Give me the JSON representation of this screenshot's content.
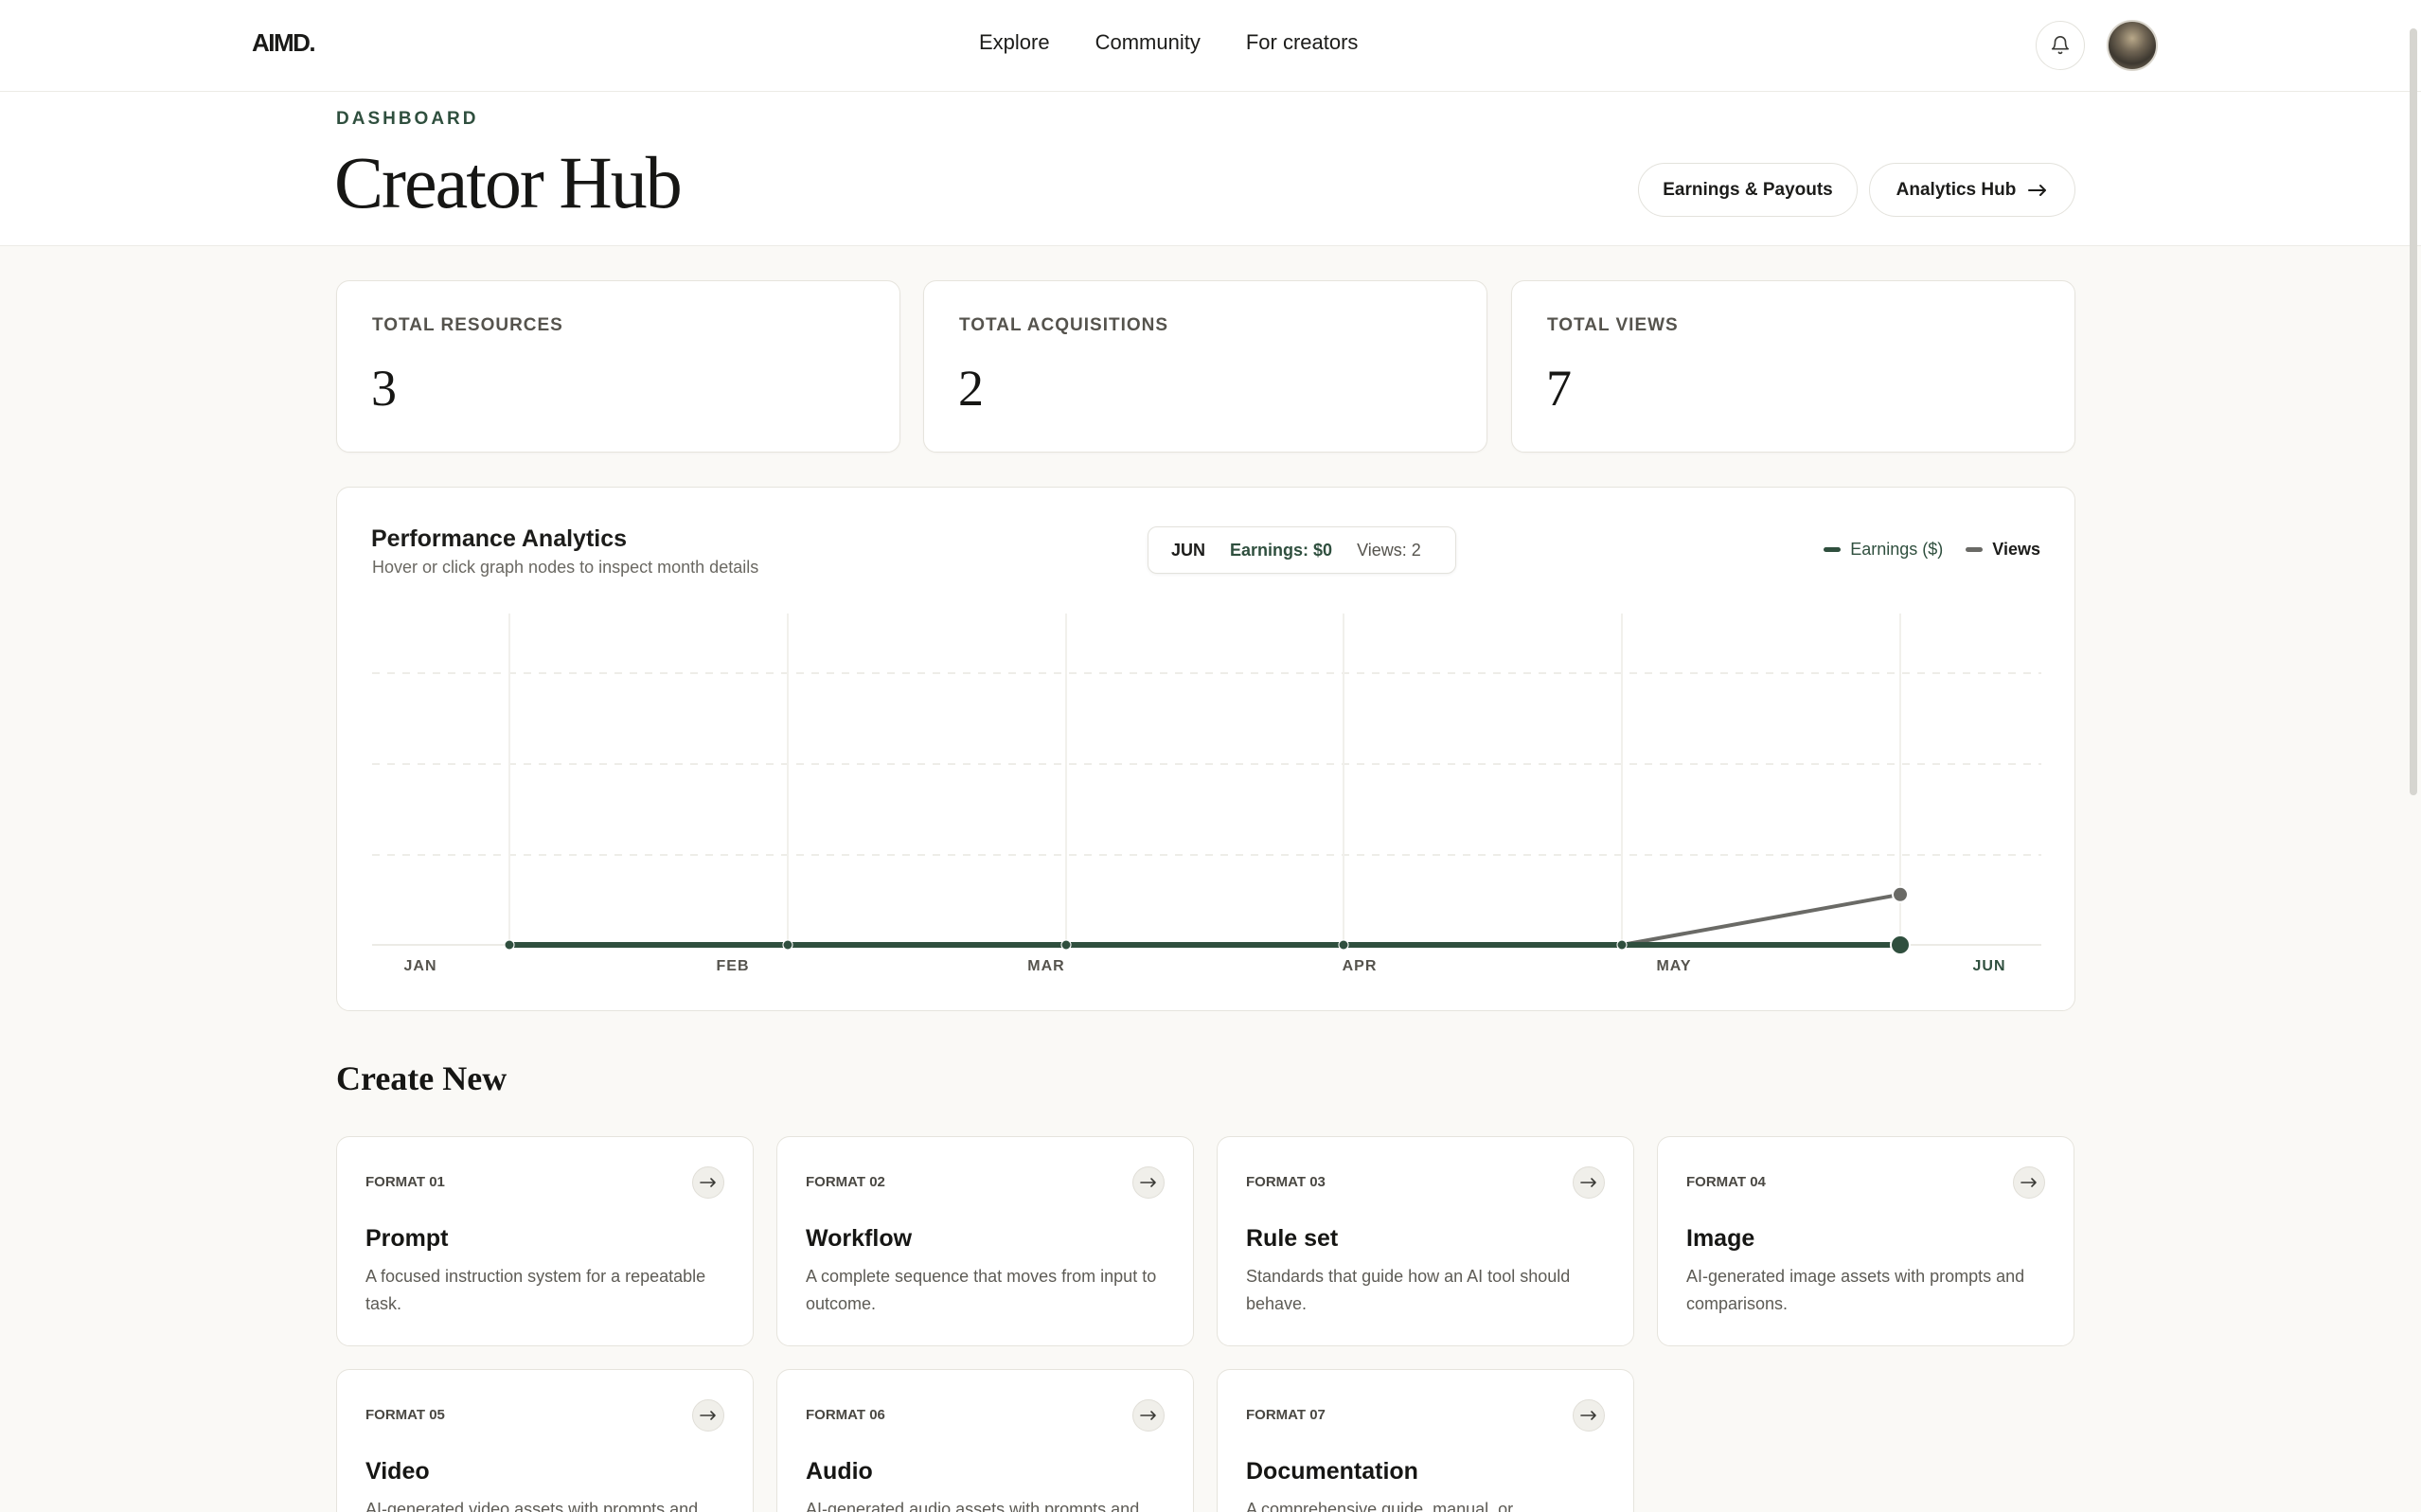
{
  "app": {
    "logo": "AIMD."
  },
  "nav": {
    "items": [
      "Explore",
      "Community",
      "For creators"
    ]
  },
  "header": {
    "eyebrow": "DASHBOARD",
    "title": "Creator Hub",
    "earnings_button": "Earnings & Payouts",
    "analytics_button": "Analytics Hub"
  },
  "stats": [
    {
      "label": "TOTAL RESOURCES",
      "value": "3"
    },
    {
      "label": "TOTAL ACQUISITIONS",
      "value": "2"
    },
    {
      "label": "TOTAL VIEWS",
      "value": "7"
    }
  ],
  "analytics": {
    "title": "Performance Analytics",
    "subtitle": "Hover or click graph nodes to inspect month details",
    "selected": {
      "month": "JUN",
      "earnings": "Earnings: $0",
      "views": "Views: 2"
    },
    "legend": [
      {
        "name": "Earnings ($)",
        "color": "#2f4f3e"
      },
      {
        "name": "Views",
        "color": "#6a6a66"
      }
    ]
  },
  "chart_data": {
    "type": "line",
    "categories": [
      "JAN",
      "FEB",
      "MAR",
      "APR",
      "MAY",
      "JUN"
    ],
    "series": [
      {
        "name": "Earnings ($)",
        "values": [
          0,
          0,
          0,
          0,
          0,
          0
        ],
        "color": "#2f4f3e"
      },
      {
        "name": "Views",
        "values": [
          0,
          0,
          0,
          0,
          0,
          2
        ],
        "color": "#6a6a66"
      }
    ],
    "ylim": [
      0,
      8
    ],
    "grid": true,
    "legend": "top-right"
  },
  "create": {
    "title": "Create New",
    "formats": [
      {
        "eyebrow": "FORMAT 01",
        "name": "Prompt",
        "desc": "A focused instruction system for a repeatable task."
      },
      {
        "eyebrow": "FORMAT 02",
        "name": "Workflow",
        "desc": "A complete sequence that moves from input to outcome."
      },
      {
        "eyebrow": "FORMAT 03",
        "name": "Rule set",
        "desc": "Standards that guide how an AI tool should behave."
      },
      {
        "eyebrow": "FORMAT 04",
        "name": "Image",
        "desc": "AI-generated image assets with prompts and comparisons."
      },
      {
        "eyebrow": "FORMAT 05",
        "name": "Video",
        "desc": "AI-generated video assets with prompts and"
      },
      {
        "eyebrow": "FORMAT 06",
        "name": "Audio",
        "desc": "AI-generated audio assets with prompts and"
      },
      {
        "eyebrow": "FORMAT 07",
        "name": "Documentation",
        "desc": "A comprehensive guide, manual, or"
      }
    ]
  }
}
